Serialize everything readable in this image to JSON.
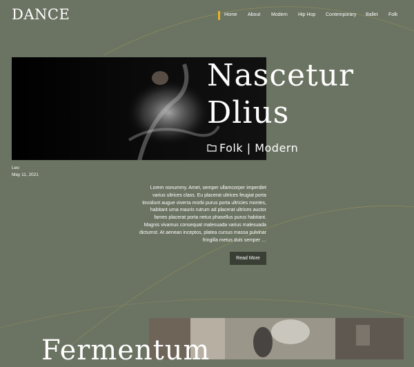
{
  "site": {
    "logo": "DANCE"
  },
  "nav": {
    "accent_color": "#e6b325",
    "items": [
      {
        "label": "Home"
      },
      {
        "label": "About"
      },
      {
        "label": "Modern"
      },
      {
        "label": "Hip Hop"
      },
      {
        "label": "Contemporary"
      },
      {
        "label": "Ballet"
      },
      {
        "label": "Folk"
      }
    ]
  },
  "posts": [
    {
      "title": "Nascetur Dlius",
      "categories": "Folk | Modern",
      "category_icon": "folder-icon",
      "author": "Leo",
      "date": "May 11, 2021",
      "excerpt": "Lorem nonummy. Amet, semper ullamcorper imperdiet varius ultrices class. Eu placerat ultrices feugiat porta tincidunt augue viverra morbi purus porta ultricies montes, habitant urna mauris rutrum ad placerat ultrices auctor fames placerat porta netus phasellus purus habitant. Magnis vivamus consequat malesuada varius malesuada dictumst. At aenean inceptos, platea cursus massa pulvinar fringilla metus duis semper …",
      "read_more": "Read More"
    },
    {
      "title": "Fermentum"
    }
  ],
  "colors": {
    "background": "#6b7362",
    "button": "#3a3f35",
    "text": "#ffffff"
  }
}
